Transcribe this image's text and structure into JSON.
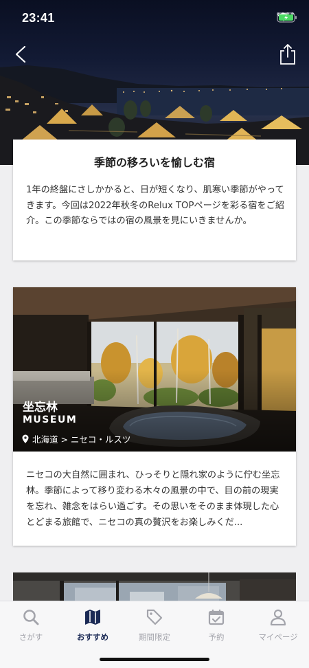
{
  "status_bar": {
    "time": "23:41"
  },
  "intro": {
    "title": "季節の移ろいを愉しむ宿",
    "body": "1年の終盤にさしかかると、日が短くなり、肌寒い季節がやってきます。今回は2022年秋冬のRelux TOPページを彩る宿をご紹介。この季節ならではの宿の風景を見にいきませんか。"
  },
  "hotel": {
    "name": "坐忘林",
    "subtitle": "MUSEUM",
    "location": "北海道 > ニセコ・ルスツ",
    "description": "ニセコの大自然に囲まれ、ひっそりと隠れ家のように佇む坐忘林。季節によって移り変わる木々の風景の中で、目の前の現実を忘れ、雑念をはらい過ごす。その思いをそのまま体現した心とどまる旅館で、ニセコの真の贅沢をお楽しみくだ..."
  },
  "tabbar": {
    "items": [
      {
        "label": "さがす",
        "icon": "search-icon",
        "active": false
      },
      {
        "label": "おすすめ",
        "icon": "map-icon",
        "active": true
      },
      {
        "label": "期間限定",
        "icon": "tag-icon",
        "active": false
      },
      {
        "label": "予約",
        "icon": "calendar-check-icon",
        "active": false
      },
      {
        "label": "マイページ",
        "icon": "person-icon",
        "active": false
      }
    ]
  },
  "colors": {
    "accent": "#1b2a55",
    "inactive": "#a3a4ab",
    "battery": "#4cd964"
  }
}
